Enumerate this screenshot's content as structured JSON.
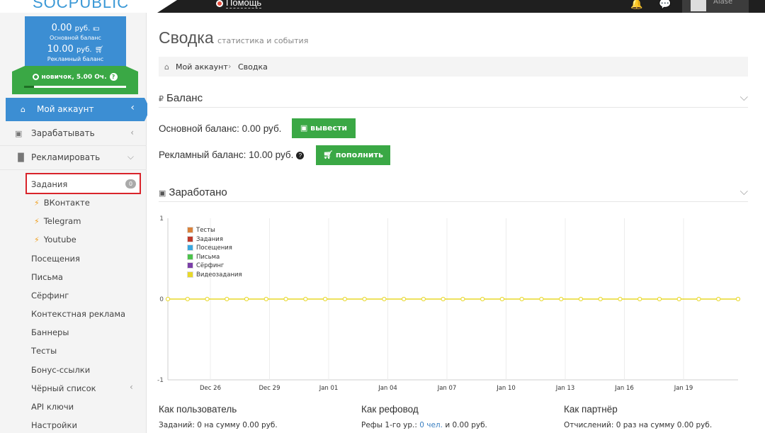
{
  "header": {
    "logo": "SOCPUBLIC",
    "help_label": "Помощь",
    "username": "Alase"
  },
  "balance_box": {
    "main_value": "0.00",
    "main_currency": "руб.",
    "main_label": "Основной баланс",
    "ad_value": "10.00",
    "ad_currency": "руб.",
    "ad_label": "Рекламный баланс",
    "rank_label": "новичок, 5.00 Оч.",
    "rank_progress": 0.1
  },
  "sidebar": {
    "items": [
      {
        "label": "Мой аккаунт",
        "icon": "home-icon"
      },
      {
        "label": "Зарабатывать",
        "icon": "briefcase-icon"
      },
      {
        "label": "Рекламировать",
        "icon": "bar-chart-icon"
      }
    ],
    "subitems": {
      "tasks": {
        "label": "Задания",
        "badge": "0"
      },
      "vk": "ВКонтакте",
      "telegram": "Telegram",
      "youtube": "Youtube",
      "visits": "Посещения",
      "letters": "Письма",
      "surfing": "Сёрфинг",
      "context": "Контекстная реклама",
      "banners": "Баннеры",
      "tests": "Тесты",
      "bonus": "Бонус-ссылки",
      "blacklist": "Чёрный список",
      "api": "API ключи",
      "settings": "Настройки"
    }
  },
  "page": {
    "title": "Сводка",
    "subtitle": "статистика и события",
    "breadcrumb": [
      "Мой аккаунт",
      "Сводка"
    ]
  },
  "balance_section": {
    "title": "Баланс",
    "main_line": "Основной баланс: 0.00 руб.",
    "withdraw_label": "вывести",
    "ad_line": "Рекламный баланс: 10.00 руб.",
    "topup_label": "пополнить"
  },
  "earned_section": {
    "title": "Заработано"
  },
  "chart_data": {
    "type": "line",
    "ylim": [
      -1,
      1
    ],
    "yticks": [
      "1",
      "0",
      "-1"
    ],
    "xtick_labels": [
      "Dec 26",
      "Dec 29",
      "Jan 01",
      "Jan 04",
      "Jan 07",
      "Jan 10",
      "Jan 13",
      "Jan 16",
      "Jan 19"
    ],
    "legend": [
      {
        "name": "Тесты",
        "color": "#d9823b"
      },
      {
        "name": "Задания",
        "color": "#c0392b"
      },
      {
        "name": "Посещения",
        "color": "#3aa8e0"
      },
      {
        "name": "Письма",
        "color": "#4cc24c"
      },
      {
        "name": "Сёрфинг",
        "color": "#7b3fa8"
      },
      {
        "name": "Видеозадания",
        "color": "#e8d82a"
      }
    ],
    "series_values": [
      0,
      0,
      0,
      0,
      0,
      0,
      0,
      0,
      0,
      0,
      0,
      0,
      0,
      0,
      0,
      0,
      0,
      0,
      0,
      0,
      0,
      0,
      0,
      0,
      0,
      0,
      0,
      0,
      0,
      0
    ],
    "line_color": "#e8d82a"
  },
  "stats": {
    "user": {
      "title": "Как пользователь",
      "text": "Заданий: 0 на сумму 0.00 руб."
    },
    "referral": {
      "title": "Как рефовод",
      "text_prefix": "Рефы 1-го ур.:",
      "link": "0 чел.",
      "text_suffix": "и 0.00 руб."
    },
    "partner": {
      "title": "Как партнёр",
      "text": "Отчислений: 0 раз на сумму 0.00 руб."
    }
  }
}
